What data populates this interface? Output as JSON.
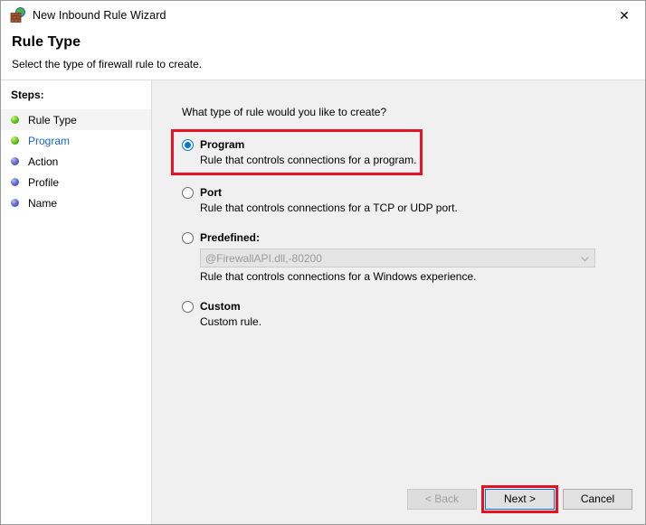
{
  "window": {
    "title": "New Inbound Rule Wizard",
    "icon": "firewall-icon",
    "close_label": "✕"
  },
  "header": {
    "title": "Rule Type",
    "subtitle": "Select the type of firewall rule to create."
  },
  "sidebar": {
    "heading": "Steps:",
    "items": [
      {
        "label": "Rule Type",
        "bullet": "green",
        "state": "current"
      },
      {
        "label": "Program",
        "bullet": "green",
        "state": "link"
      },
      {
        "label": "Action",
        "bullet": "blue",
        "state": "pending"
      },
      {
        "label": "Profile",
        "bullet": "blue",
        "state": "pending"
      },
      {
        "label": "Name",
        "bullet": "blue",
        "state": "pending"
      }
    ]
  },
  "main": {
    "question": "What type of rule would you like to create?",
    "options": [
      {
        "id": "program",
        "title": "Program",
        "description": "Rule that controls connections for a program.",
        "selected": true,
        "highlighted": true
      },
      {
        "id": "port",
        "title": "Port",
        "description": "Rule that controls connections for a TCP or UDP port.",
        "selected": false,
        "highlighted": false
      },
      {
        "id": "predefined",
        "title": "Predefined:",
        "description": "Rule that controls connections for a Windows experience.",
        "selected": false,
        "highlighted": false,
        "combo_value": "@FirewallAPI.dll,-80200",
        "combo_disabled": true
      },
      {
        "id": "custom",
        "title": "Custom",
        "description": "Custom rule.",
        "selected": false,
        "highlighted": false
      }
    ]
  },
  "buttons": {
    "back": {
      "label": "< Back",
      "disabled": true
    },
    "next": {
      "label": "Next >",
      "disabled": false,
      "focused": true,
      "highlighted": true
    },
    "cancel": {
      "label": "Cancel",
      "disabled": false
    }
  },
  "colors": {
    "accent": "#0078d7",
    "highlight": "#e81123",
    "panel": "#f0f0f0",
    "link": "#1766cc"
  }
}
